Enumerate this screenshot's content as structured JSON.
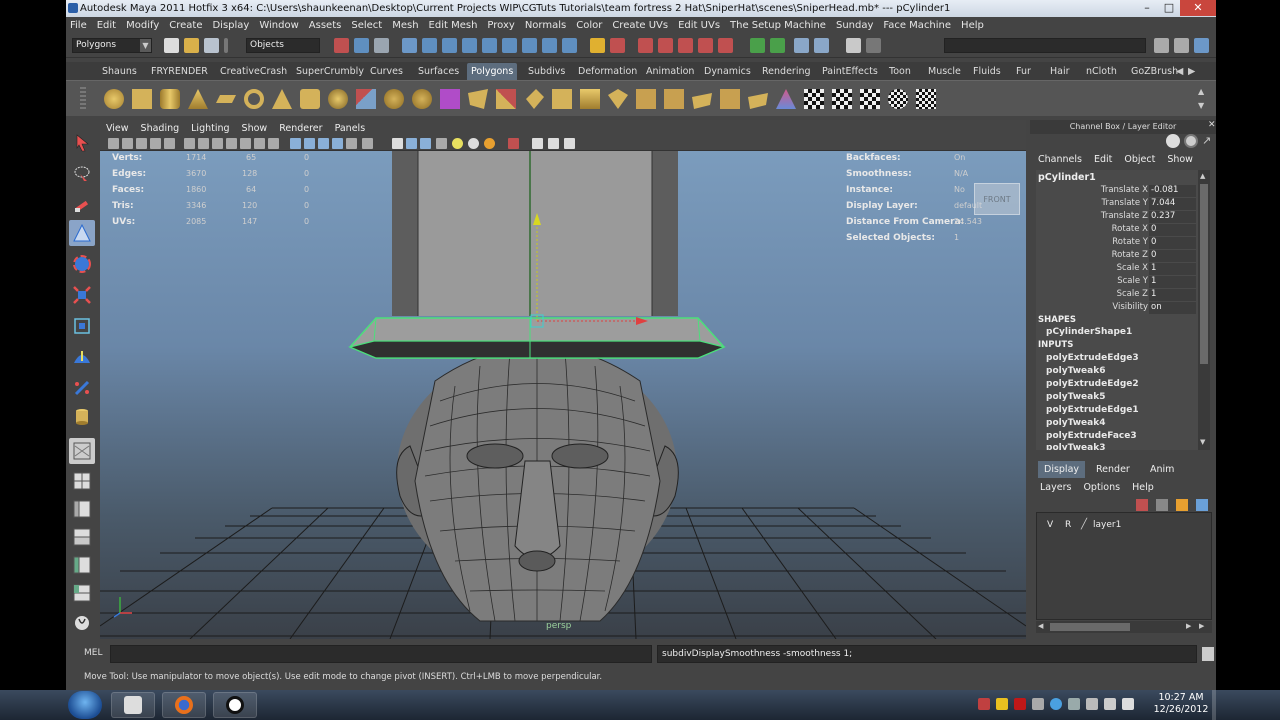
{
  "window": {
    "title": "Autodesk Maya 2011 Hotfix 3 x64: C:\\Users\\shaunkeenan\\Desktop\\Current Projects WIP\\CGTuts Tutorials\\team fortress 2 Hat\\SniperHat\\scenes\\SniperHead.mb*   ---   pCylinder1",
    "controls": [
      "–",
      "□",
      "✕"
    ]
  },
  "menubar": [
    "File",
    "Edit",
    "Modify",
    "Create",
    "Display",
    "Window",
    "Assets",
    "Select",
    "Mesh",
    "Edit Mesh",
    "Proxy",
    "Normals",
    "Color",
    "Create UVs",
    "Edit UVs",
    "The Setup Machine",
    "Sunday",
    "Face Machine",
    "Help"
  ],
  "statusline": {
    "menuset": "Polygons",
    "selection_mode": "Objects"
  },
  "shelf": {
    "tabs": [
      "Shauns",
      "FRYRENDER",
      "CreativeCrash",
      "SuperCrumbly",
      "Curves",
      "Surfaces",
      "Polygons",
      "Subdivs",
      "Deformation",
      "Animation",
      "Dynamics",
      "Rendering",
      "PaintEffects",
      "Toon",
      "Muscle",
      "Fluids",
      "Fur",
      "Hair",
      "nCloth",
      "GoZBrush"
    ],
    "active_tab": "Polygons"
  },
  "viewport": {
    "menu": [
      "View",
      "Shading",
      "Lighting",
      "Show",
      "Renderer",
      "Panels"
    ],
    "camera_label": "persp",
    "view_cube_label": "FRONT",
    "hud_left": [
      {
        "label": "Verts:",
        "v1": "1714",
        "v2": "65",
        "v3": "0"
      },
      {
        "label": "Edges:",
        "v1": "3670",
        "v2": "128",
        "v3": "0"
      },
      {
        "label": "Faces:",
        "v1": "1860",
        "v2": "64",
        "v3": "0"
      },
      {
        "label": "Tris:",
        "v1": "3346",
        "v2": "120",
        "v3": "0"
      },
      {
        "label": "UVs:",
        "v1": "2085",
        "v2": "147",
        "v3": "0"
      }
    ],
    "hud_right": [
      {
        "label": "Backfaces:",
        "value": "On"
      },
      {
        "label": "Smoothness:",
        "value": "N/A"
      },
      {
        "label": "Instance:",
        "value": "No"
      },
      {
        "label": "Display Layer:",
        "value": "default"
      },
      {
        "label": "Distance From Camera:",
        "value": "24.543"
      },
      {
        "label": "Selected Objects:",
        "value": "1"
      }
    ]
  },
  "channel_box": {
    "title": "Channel Box / Layer Editor",
    "menu": [
      "Channels",
      "Edit",
      "Object",
      "Show"
    ],
    "object": "pCylinder1",
    "attributes": [
      {
        "name": "Translate X",
        "value": "-0.081"
      },
      {
        "name": "Translate Y",
        "value": "7.044"
      },
      {
        "name": "Translate Z",
        "value": "0.237"
      },
      {
        "name": "Rotate X",
        "value": "0"
      },
      {
        "name": "Rotate Y",
        "value": "0"
      },
      {
        "name": "Rotate Z",
        "value": "0"
      },
      {
        "name": "Scale X",
        "value": "1"
      },
      {
        "name": "Scale Y",
        "value": "1"
      },
      {
        "name": "Scale Z",
        "value": "1"
      },
      {
        "name": "Visibility",
        "value": "on"
      }
    ],
    "shapes_header": "SHAPES",
    "shape": "pCylinderShape1",
    "inputs_header": "INPUTS",
    "inputs": [
      "polyExtrudeEdge3",
      "polyTweak6",
      "polyExtrudeEdge2",
      "polyTweak5",
      "polyExtrudeEdge1",
      "polyTweak4",
      "polyExtrudeFace3",
      "polyTweak3"
    ]
  },
  "layer_editor": {
    "tabs": [
      "Display",
      "Render",
      "Anim"
    ],
    "active_tab": "Display",
    "menu": [
      "Layers",
      "Options",
      "Help"
    ],
    "layers": [
      {
        "v": "V",
        "r": "R",
        "name": "layer1"
      }
    ]
  },
  "command_line": {
    "label": "MEL",
    "result": "subdivDisplaySmoothness -smoothness 1;"
  },
  "help_line": "Move Tool: Use manipulator to move object(s). Use edit mode to change pivot (INSERT). Ctrl+LMB to move perpendicular.",
  "taskbar": {
    "time": "10:27 AM",
    "date": "12/26/2012"
  }
}
